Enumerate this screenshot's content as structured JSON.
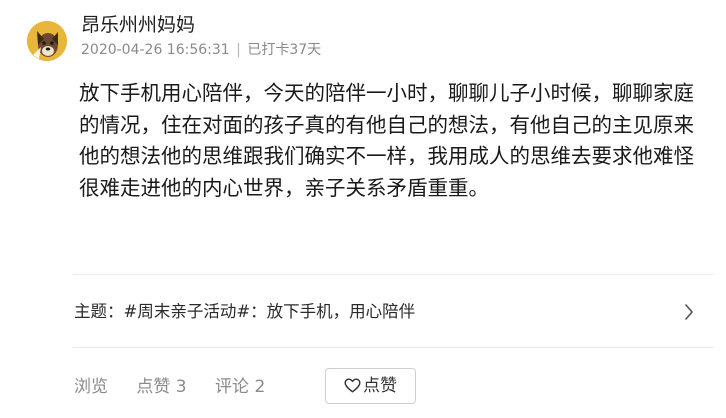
{
  "post": {
    "author": "昂乐州州妈妈",
    "timestamp": "2020-04-26 16:56:31",
    "separator": "|",
    "checkin": "已打卡37天",
    "content": "放下手机用心陪伴，今天的陪伴一小时，聊聊儿子小时候，聊聊家庭的情况，住在对面的孩子真的有他自己的想法，有他自己的主见原来他的想法他的思维跟我们确实不一样，我用成人的思维去要求他难怪很难走进他的内心世界，亲子关系矛盾重重。",
    "topic": "主题：#周末亲子活动#：放下手机，用心陪伴"
  },
  "actions": {
    "views_label": "浏览",
    "likes_label": "点赞 3",
    "comments_label": "评论 2",
    "like_button_label": "点赞"
  },
  "icons": {
    "avatar": "cartoon-dog-avatar",
    "topic_arrow": "chevron-right-icon",
    "like": "heart-outline-icon"
  },
  "colors": {
    "avatar_bg": "#e8b63a",
    "meta_text": "#8a8a8a",
    "action_text": "#8a8a8a"
  }
}
